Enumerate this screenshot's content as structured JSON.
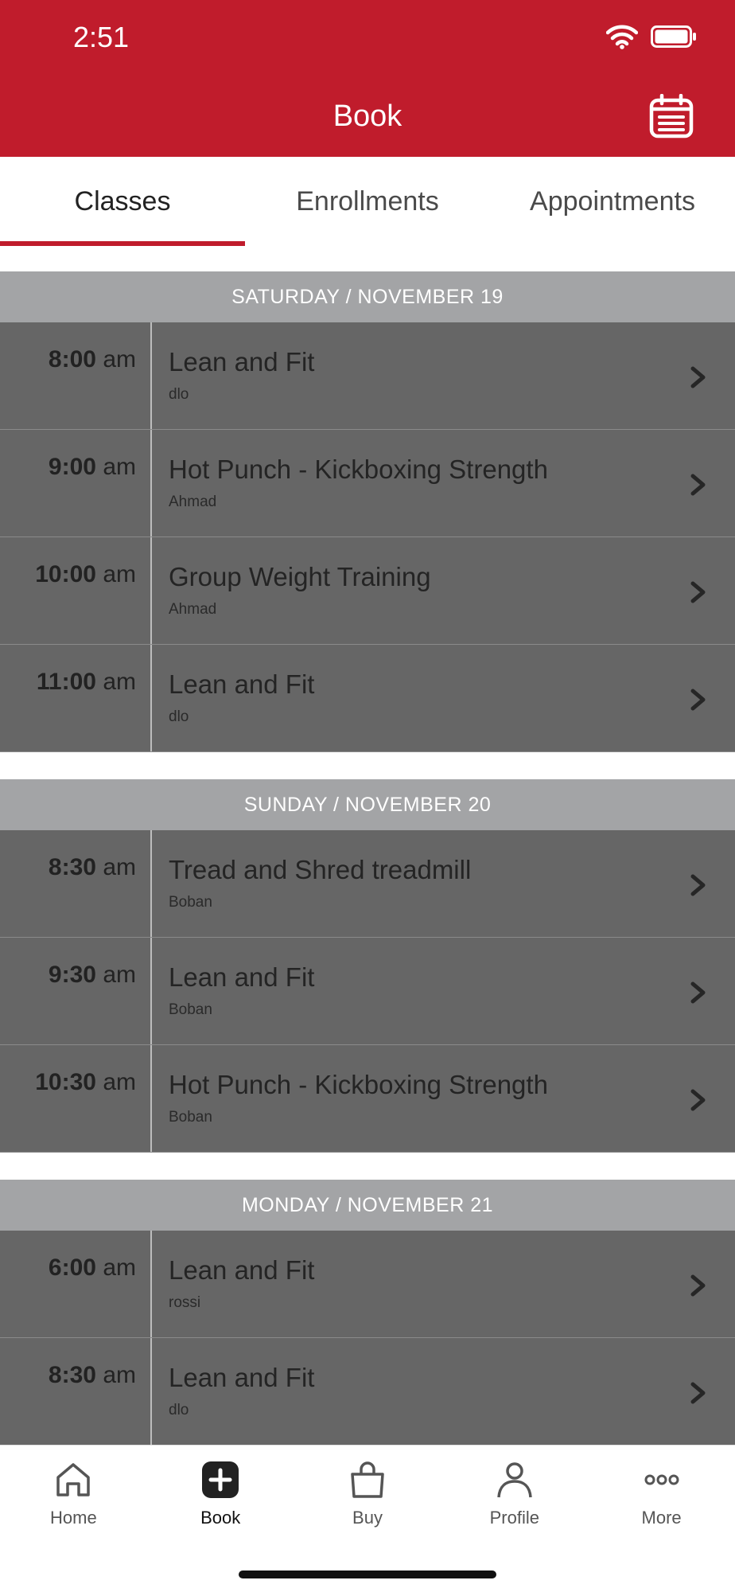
{
  "status_bar": {
    "time": "2:51"
  },
  "header": {
    "title": "Book"
  },
  "tabs": [
    {
      "label": "Classes",
      "active": true
    },
    {
      "label": "Enrollments",
      "active": false
    },
    {
      "label": "Appointments",
      "active": false
    }
  ],
  "days": [
    {
      "header": "SATURDAY / NOVEMBER 19",
      "classes": [
        {
          "time": "8:00",
          "ampm": "am",
          "name": "Lean and Fit",
          "instructor": "dlo"
        },
        {
          "time": "9:00",
          "ampm": "am",
          "name": "Hot Punch - Kickboxing Strength",
          "instructor": "Ahmad"
        },
        {
          "time": "10:00",
          "ampm": "am",
          "name": "Group Weight Training",
          "instructor": "Ahmad"
        },
        {
          "time": "11:00",
          "ampm": "am",
          "name": "Lean and Fit",
          "instructor": "dlo"
        }
      ]
    },
    {
      "header": "SUNDAY / NOVEMBER 20",
      "classes": [
        {
          "time": "8:30",
          "ampm": "am",
          "name": "Tread and Shred treadmill",
          "instructor": "Boban"
        },
        {
          "time": "9:30",
          "ampm": "am",
          "name": "Lean and Fit",
          "instructor": "Boban"
        },
        {
          "time": "10:30",
          "ampm": "am",
          "name": "Hot Punch - Kickboxing Strength",
          "instructor": "Boban"
        }
      ]
    },
    {
      "header": "MONDAY / NOVEMBER 21",
      "classes": [
        {
          "time": "6:00",
          "ampm": "am",
          "name": "Lean and Fit",
          "instructor": "rossi"
        },
        {
          "time": "8:30",
          "ampm": "am",
          "name": "Lean and Fit",
          "instructor": "dlo"
        }
      ]
    }
  ],
  "bottom_nav": [
    {
      "label": "Home",
      "icon": "home-icon"
    },
    {
      "label": "Book",
      "icon": "book-plus-icon",
      "active": true
    },
    {
      "label": "Buy",
      "icon": "shopping-bag-icon"
    },
    {
      "label": "Profile",
      "icon": "profile-icon"
    },
    {
      "label": "More",
      "icon": "more-icon"
    }
  ],
  "colors": {
    "brand": "#C01C2C",
    "row_bg": "#666666",
    "day_header_bg": "#A3A4A6"
  }
}
